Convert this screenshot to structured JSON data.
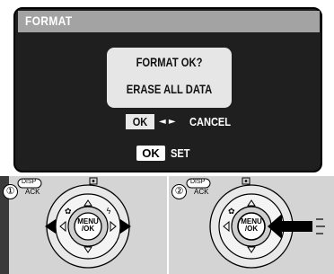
{
  "screen": {
    "title": "FORMAT",
    "message_line1": "FORMAT OK?",
    "message_line2": "ERASE ALL DATA",
    "option_ok": "OK",
    "option_arrows": "◄ ►",
    "option_cancel": "CANCEL",
    "footer_ok": "OK",
    "footer_set": "SET"
  },
  "steps": [
    {
      "number": "①",
      "disp_label": "DISP",
      "back_label": "ACK",
      "menu_label_1": "MENU",
      "menu_label_2": "/OK"
    },
    {
      "number": "②",
      "disp_label": "DISP",
      "back_label": "ACK",
      "menu_label_1": "MENU",
      "menu_label_2": "/OK"
    }
  ],
  "colors": {
    "screen_bg": "#1f1f1f",
    "titlebar": "#a3a3a3",
    "camera_body": "#d4d4d4"
  }
}
